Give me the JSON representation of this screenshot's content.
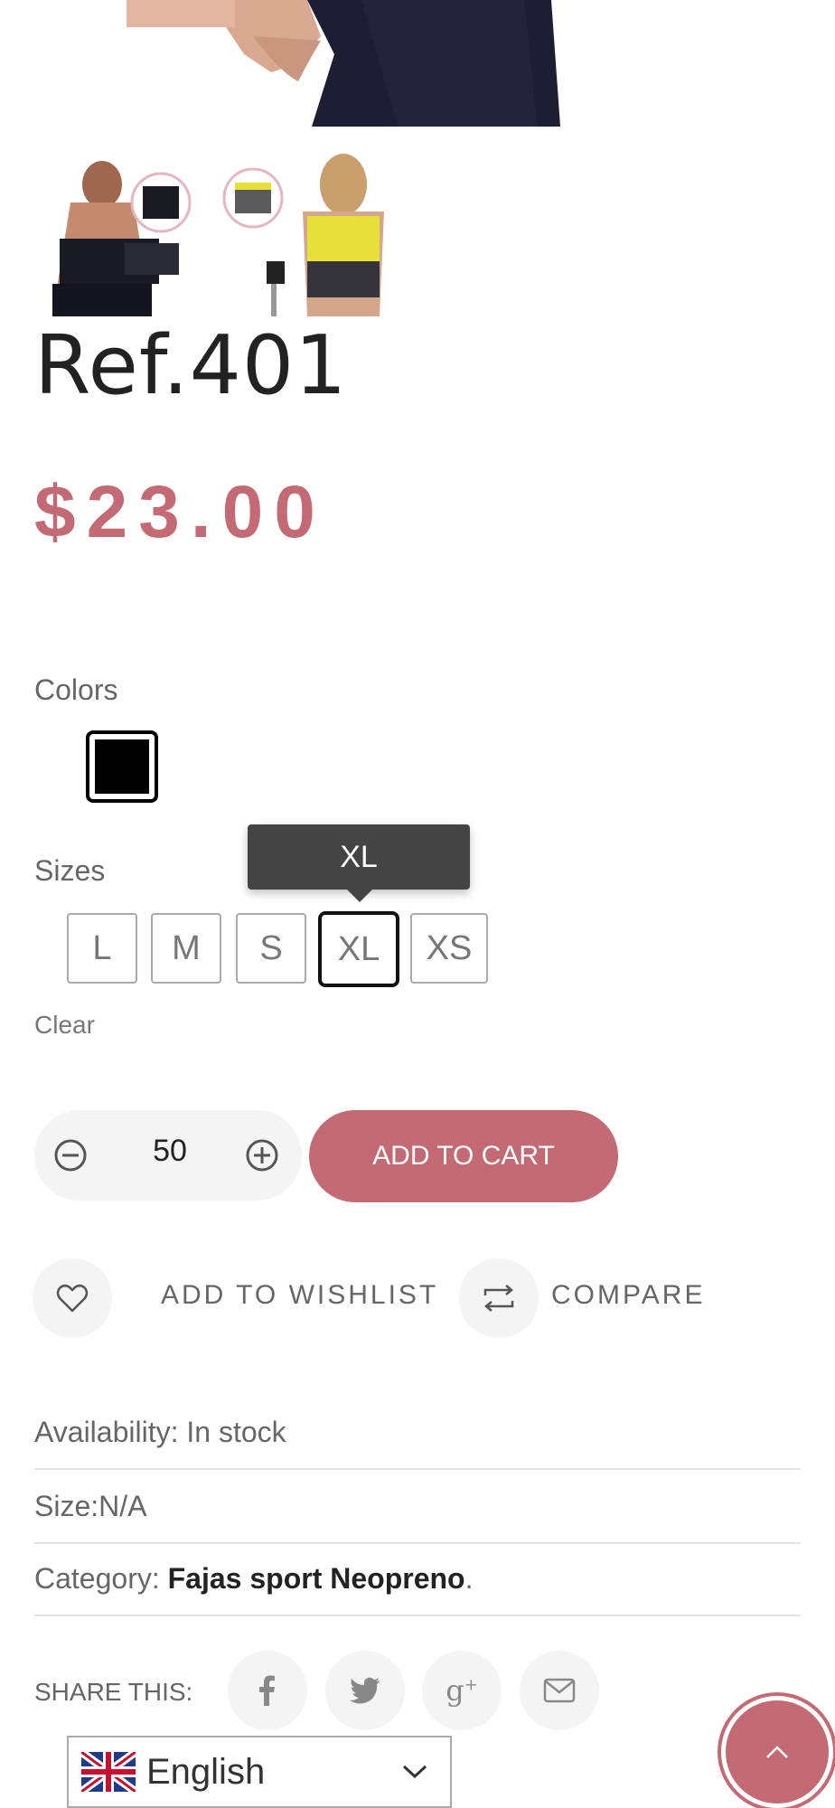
{
  "product": {
    "title": "Ref.401",
    "price": "$23.00"
  },
  "colors": {
    "label": "Colors",
    "options": [
      {
        "name": "black",
        "hex": "#000000"
      }
    ]
  },
  "sizes": {
    "label": "Sizes",
    "options": [
      "L",
      "M",
      "S",
      "XL",
      "XS"
    ],
    "selected": "XL",
    "tooltip": "XL",
    "clear_label": "Clear"
  },
  "quantity": {
    "value": "50",
    "minus_icon": "minus-circle-icon",
    "plus_icon": "plus-circle-icon"
  },
  "actions": {
    "add_to_cart": "ADD TO CART",
    "wishlist": "ADD TO WISHLIST",
    "compare": "COMPARE"
  },
  "meta": {
    "availability_label": "Availability:",
    "availability_value": "In stock",
    "size": "Size:N/A",
    "category_label": "Category:",
    "category_value": "Fajas sport Neopreno",
    "category_suffix": "."
  },
  "share": {
    "label": "SHARE THIS:",
    "networks": [
      "facebook",
      "twitter",
      "google-plus",
      "email"
    ]
  },
  "language": {
    "label": "English",
    "flag": "uk-flag-icon"
  },
  "theme": {
    "accent": "#c46a74",
    "tooltip_bg": "#444444"
  }
}
